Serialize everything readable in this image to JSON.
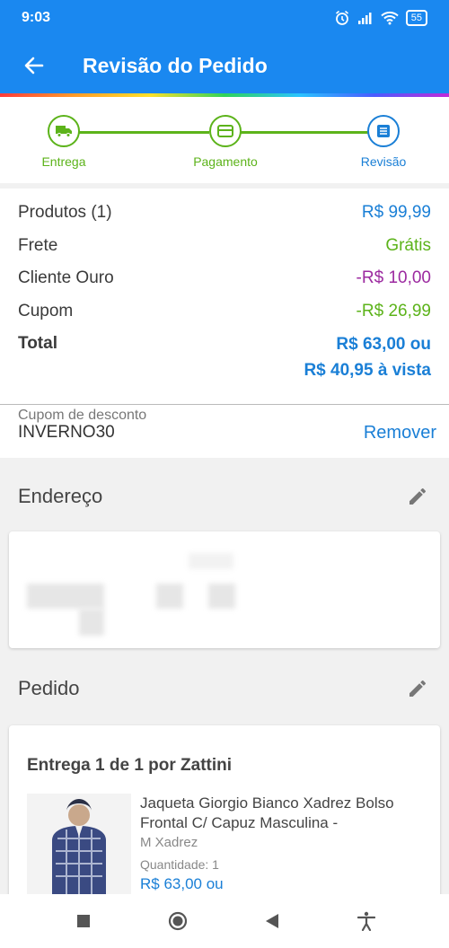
{
  "status_bar": {
    "time": "9:03",
    "battery": "55"
  },
  "header": {
    "title": "Revisão do Pedido"
  },
  "stepper": {
    "steps": [
      {
        "label": "Entrega",
        "icon": "truck-icon",
        "color": "#5cb31a"
      },
      {
        "label": "Pagamento",
        "icon": "card-icon",
        "color": "#5cb31a"
      },
      {
        "label": "Revisão",
        "icon": "receipt-icon",
        "color": "#1a7fd6"
      }
    ]
  },
  "summary": {
    "rows": [
      {
        "label": "Produtos (1)",
        "value": "R$ 99,99",
        "color": "#1a7fd6"
      },
      {
        "label": "Frete",
        "value": "Grátis",
        "color": "#5cb31a"
      },
      {
        "label": "Cliente Ouro",
        "value": "-R$ 10,00",
        "color": "#9c2aa0"
      },
      {
        "label": "Cupom",
        "value": "-R$ 26,99",
        "color": "#5cb31a"
      }
    ],
    "total_label": "Total",
    "total_value_1": "R$ 63,00 ou",
    "total_value_2": "R$ 40,95 à vista"
  },
  "coupon": {
    "caption": "Cupom de desconto",
    "code": "INVERNO30",
    "remove_label": "Remover"
  },
  "address": {
    "title": "Endereço"
  },
  "order": {
    "title": "Pedido",
    "delivery_title": "Entrega 1 de 1 por Zattini",
    "product": {
      "name": "Jaqueta Giorgio Bianco Xadrez Bolso Frontal C/ Capuz Masculina -",
      "variant": "M Xadrez",
      "quantity": "Quantidade:  1",
      "price": "R$ 63,00 ou"
    }
  }
}
